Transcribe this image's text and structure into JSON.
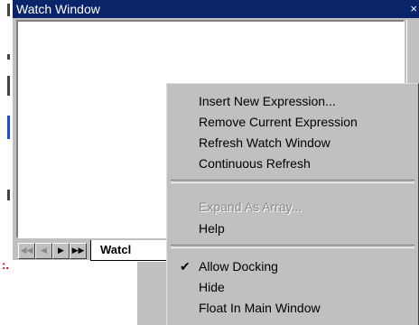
{
  "window": {
    "title": "Watch Window",
    "close_glyph": "×"
  },
  "tabs": {
    "watch_label": "Watcl",
    "nav": [
      "◀◀",
      "◀",
      "▶",
      "▶▶"
    ]
  },
  "side_mark": ":.",
  "context_menu": {
    "items": [
      {
        "name": "insert-new-expression",
        "label": "Insert New Expression...",
        "enabled": true
      },
      {
        "name": "remove-current-expression",
        "label": "Remove Current Expression",
        "enabled": true
      },
      {
        "name": "refresh-watch-window",
        "label": "Refresh Watch Window",
        "enabled": true
      },
      {
        "name": "continuous-refresh",
        "label": "Continuous Refresh",
        "enabled": true
      },
      {
        "name": "expand-as-array",
        "label": "Expand As Array...",
        "enabled": false
      },
      {
        "name": "help",
        "label": "Help",
        "enabled": true
      },
      {
        "name": "allow-docking",
        "label": "Allow Docking",
        "enabled": true,
        "checked": true
      },
      {
        "name": "hide",
        "label": "Hide",
        "enabled": true
      },
      {
        "name": "float-in-main-window",
        "label": "Float In Main Window",
        "enabled": true
      }
    ],
    "check_glyph": "✔"
  },
  "colors": {
    "title_bar": "#0a246a",
    "menu_face": "#c0c0c0",
    "disabled_text": "#8a8a8a",
    "mark_red": "#cc0000"
  }
}
